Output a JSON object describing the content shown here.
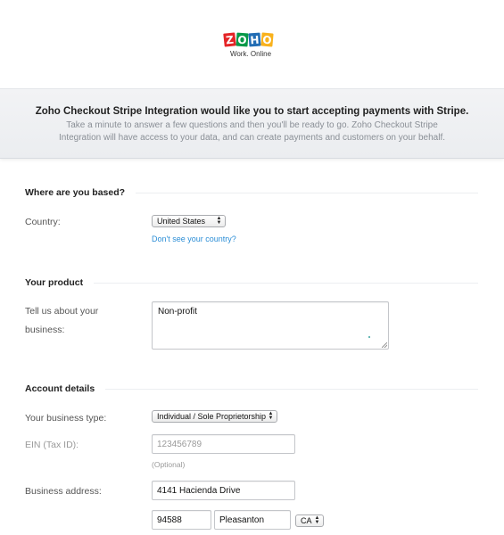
{
  "logo": {
    "letters": [
      {
        "char": "Z",
        "color": "#e42527"
      },
      {
        "char": "O",
        "color": "#089949"
      },
      {
        "char": "H",
        "color": "#226db4"
      },
      {
        "char": "O",
        "color": "#f9b21d"
      }
    ],
    "tagline": "Work. Online"
  },
  "banner": {
    "title": "Zoho Checkout Stripe Integration would like you to start accepting payments with Stripe.",
    "subtitle": "Take a minute to answer a few questions and then you'll be ready to go. Zoho Checkout Stripe Integration will have access to your data, and can create payments and customers on your behalf."
  },
  "sections": {
    "location": {
      "heading": "Where are you based?",
      "country_label": "Country:",
      "country_value": "United States",
      "country_link": "Don't see your country?"
    },
    "product": {
      "heading": "Your product",
      "label_line1": "Tell us about your",
      "label_line2": "business:",
      "value": "Non-profit"
    },
    "account": {
      "heading": "Account details",
      "business_type_label": "Your business type:",
      "business_type_value": "Individual / Sole Proprietorship",
      "ein_label": "EIN (Tax ID):",
      "ein_placeholder": "123456789",
      "ein_hint": "(Optional)",
      "address_label": "Business address:",
      "address_value": "4141 Hacienda Drive",
      "zip_value": "94588",
      "city_value": "Pleasanton",
      "state_value": "CA"
    }
  },
  "colors": {
    "link": "#2c8ed6"
  }
}
